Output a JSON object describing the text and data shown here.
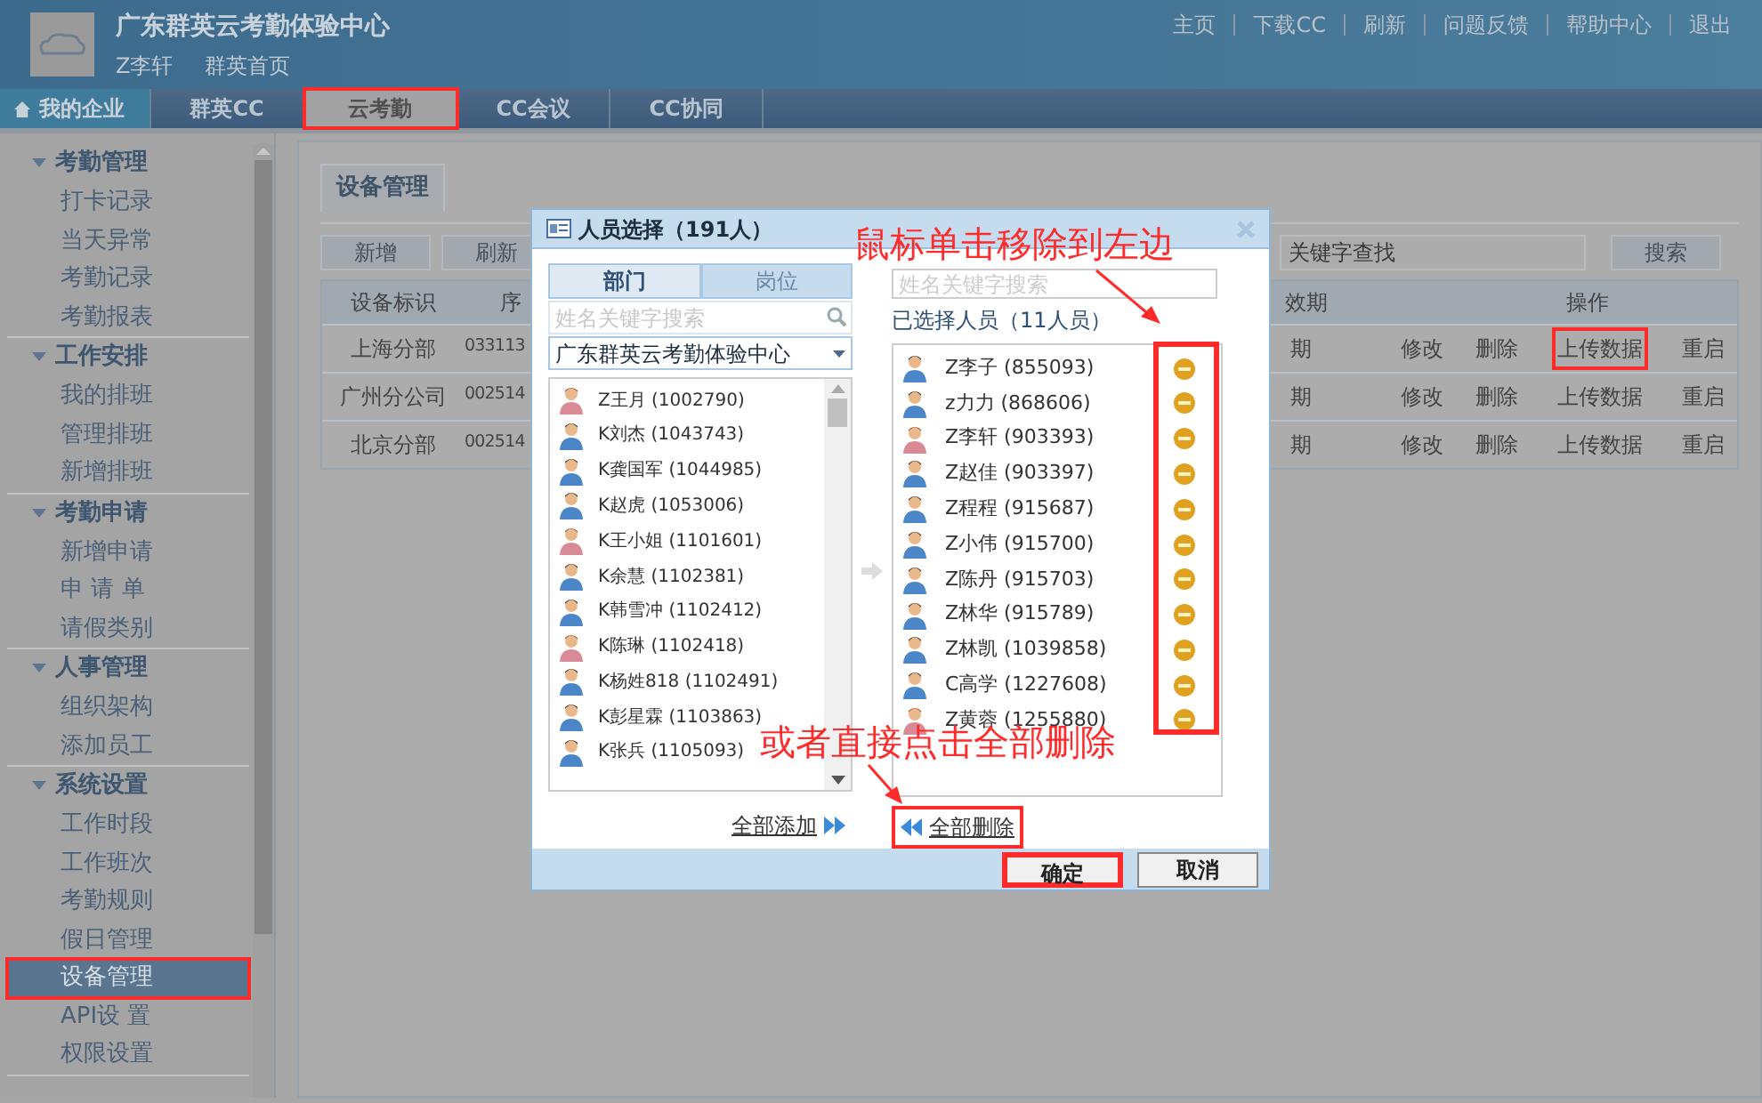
{
  "header": {
    "title": "广东群英云考勤体验中心",
    "user": "Z李轩",
    "home_link": "群英首页",
    "links": [
      "主页",
      "下载CC",
      "刷新",
      "问题反馈",
      "帮助中心",
      "退出"
    ]
  },
  "nav": {
    "home": "我的企业",
    "tabs": [
      {
        "label": "群英CC",
        "selected": false,
        "highlighted": false
      },
      {
        "label": "云考勤",
        "selected": true,
        "highlighted": true
      },
      {
        "label": "CC会议",
        "selected": false,
        "highlighted": false
      },
      {
        "label": "CC协同",
        "selected": false,
        "highlighted": false
      }
    ]
  },
  "sidebar": {
    "groups": [
      {
        "title": "考勤管理",
        "expanded": true,
        "items": [
          {
            "label": "打卡记录",
            "selected": false,
            "highlighted": false
          },
          {
            "label": "当天异常",
            "selected": false,
            "highlighted": false
          },
          {
            "label": "考勤记录",
            "selected": false,
            "highlighted": false
          },
          {
            "label": "考勤报表",
            "selected": false,
            "highlighted": false
          }
        ]
      },
      {
        "title": "工作安排",
        "expanded": true,
        "items": [
          {
            "label": "我的排班",
            "selected": false,
            "highlighted": false
          },
          {
            "label": "管理排班",
            "selected": false,
            "highlighted": false
          },
          {
            "label": "新增排班",
            "selected": false,
            "highlighted": false
          }
        ]
      },
      {
        "title": "考勤申请",
        "expanded": true,
        "items": [
          {
            "label": "新增申请",
            "selected": false,
            "highlighted": false
          },
          {
            "label": "申 请 单",
            "selected": false,
            "highlighted": false
          },
          {
            "label": "请假类别",
            "selected": false,
            "highlighted": false
          }
        ]
      },
      {
        "title": "人事管理",
        "expanded": true,
        "items": [
          {
            "label": "组织架构",
            "selected": false,
            "highlighted": false
          },
          {
            "label": "添加员工",
            "selected": false,
            "highlighted": false
          }
        ]
      },
      {
        "title": "系统设置",
        "expanded": true,
        "items": [
          {
            "label": "工作时段",
            "selected": false,
            "highlighted": false
          },
          {
            "label": "工作班次",
            "selected": false,
            "highlighted": false
          },
          {
            "label": "考勤规则",
            "selected": false,
            "highlighted": false
          },
          {
            "label": "假日管理",
            "selected": false,
            "highlighted": false
          },
          {
            "label": "设备管理",
            "selected": true,
            "highlighted": true
          },
          {
            "label": "API设 置",
            "selected": false,
            "highlighted": false
          },
          {
            "label": "权限设置",
            "selected": false,
            "highlighted": false
          }
        ]
      }
    ]
  },
  "page": {
    "tab": "设备管理",
    "buttons": [
      "新增",
      "刷新"
    ],
    "search": {
      "placeholder": "关键字查找"
    },
    "search_button": "搜索",
    "table": {
      "columns": [
        "设备标识",
        "序",
        "效期",
        "操作"
      ],
      "rows": [
        {
          "cells": [
            "上海分部",
            "033113",
            "期"
          ],
          "actions": [
            {
              "label": "修改",
              "highlighted": false
            },
            {
              "label": "删除",
              "highlighted": false
            },
            {
              "label": "上传数据",
              "highlighted": true
            },
            {
              "label": "重启",
              "highlighted": false
            }
          ]
        },
        {
          "cells": [
            "广州分公司",
            "002514",
            "期"
          ],
          "actions": [
            {
              "label": "修改",
              "highlighted": false
            },
            {
              "label": "删除",
              "highlighted": false
            },
            {
              "label": "上传数据",
              "highlighted": false
            },
            {
              "label": "重启",
              "highlighted": false
            }
          ]
        },
        {
          "cells": [
            "北京分部",
            "002514",
            "期"
          ],
          "actions": [
            {
              "label": "修改",
              "highlighted": false
            },
            {
              "label": "删除",
              "highlighted": false
            },
            {
              "label": "上传数据",
              "highlighted": false
            },
            {
              "label": "重启",
              "highlighted": false
            }
          ]
        }
      ]
    }
  },
  "dialog": {
    "title": "人员选择（191人）",
    "tabs": [
      {
        "label": "部门",
        "selected": true
      },
      {
        "label": "岗位",
        "selected": false
      }
    ],
    "left_search": {
      "placeholder": "姓名关键字搜索"
    },
    "department": "广东群英云考勤体验中心",
    "people": [
      {
        "name": "Z王月 (1002790)",
        "kind": "female"
      },
      {
        "name": "K刘杰 (1043743)",
        "kind": "male"
      },
      {
        "name": "K龚国军 (1044985)",
        "kind": "male"
      },
      {
        "name": "K赵虎 (1053006)",
        "kind": "male"
      },
      {
        "name": "K王小姐 (1101601)",
        "kind": "female"
      },
      {
        "name": "K余慧 (1102381)",
        "kind": "male"
      },
      {
        "name": "K韩雪冲 (1102412)",
        "kind": "male"
      },
      {
        "name": "K陈琳 (1102418)",
        "kind": "female"
      },
      {
        "name": "K杨姓818 (1102491)",
        "kind": "male"
      },
      {
        "name": "K彭星霖 (1103863)",
        "kind": "male"
      },
      {
        "name": "K张兵 (1105093)",
        "kind": "male"
      }
    ],
    "right_search": {
      "placeholder": "姓名关键字搜索"
    },
    "selected_label": "已选择人员（11人员）",
    "remove_column_highlighted": true,
    "selected_people": [
      {
        "name": "Z李子 (855093)",
        "kind": "male"
      },
      {
        "name": "z力力 (868606)",
        "kind": "male"
      },
      {
        "name": "Z李轩 (903393)",
        "kind": "female"
      },
      {
        "name": "Z赵佳 (903397)",
        "kind": "male"
      },
      {
        "name": "Z程程 (915687)",
        "kind": "male"
      },
      {
        "name": "Z小伟 (915700)",
        "kind": "male"
      },
      {
        "name": "Z陈丹 (915703)",
        "kind": "male"
      },
      {
        "name": "Z林华 (915789)",
        "kind": "male"
      },
      {
        "name": "Z林凯 (1039858)",
        "kind": "male"
      },
      {
        "name": "C高学 (1227608)",
        "kind": "male"
      },
      {
        "name": "Z黄蓉 (1255880)",
        "kind": "female"
      }
    ],
    "add_all": "全部添加",
    "remove_all": {
      "label": "全部删除",
      "highlighted": true
    },
    "ok": {
      "label": "确定",
      "highlighted": true
    },
    "cancel": {
      "label": "取消",
      "highlighted": false
    }
  },
  "annotations": [
    {
      "text": "鼠标单击移除到左边"
    },
    {
      "text": "或者直接点击全部删除"
    }
  ]
}
